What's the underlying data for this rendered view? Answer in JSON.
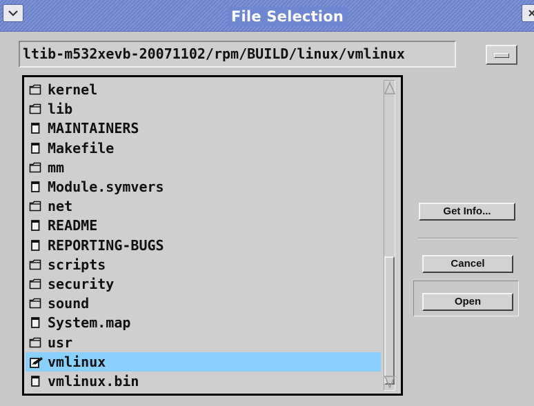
{
  "window": {
    "title": "File Selection",
    "menu_glyph": "⌄",
    "close_glyph": "✕"
  },
  "path": {
    "value": "ltib-m532xevb-20071102/rpm/BUILD/linux/vmlinux"
  },
  "file_list": {
    "items": [
      {
        "name": "kernel",
        "type": "folder"
      },
      {
        "name": "lib",
        "type": "folder"
      },
      {
        "name": "MAINTAINERS",
        "type": "file"
      },
      {
        "name": "Makefile",
        "type": "file"
      },
      {
        "name": "mm",
        "type": "folder"
      },
      {
        "name": "Module.symvers",
        "type": "file"
      },
      {
        "name": "net",
        "type": "folder"
      },
      {
        "name": "README",
        "type": "file"
      },
      {
        "name": "REPORTING-BUGS",
        "type": "file"
      },
      {
        "name": "scripts",
        "type": "folder"
      },
      {
        "name": "security",
        "type": "folder"
      },
      {
        "name": "sound",
        "type": "folder"
      },
      {
        "name": "System.map",
        "type": "file"
      },
      {
        "name": "usr",
        "type": "folder"
      },
      {
        "name": "vmlinux",
        "type": "executable",
        "selected": true
      },
      {
        "name": "vmlinux.bin",
        "type": "file"
      }
    ]
  },
  "buttons": {
    "get_info": "Get Info...",
    "cancel": "Cancel",
    "open": "Open"
  },
  "colors": {
    "selection": "#8ad0ff",
    "title_bar": "#6f86d0"
  }
}
